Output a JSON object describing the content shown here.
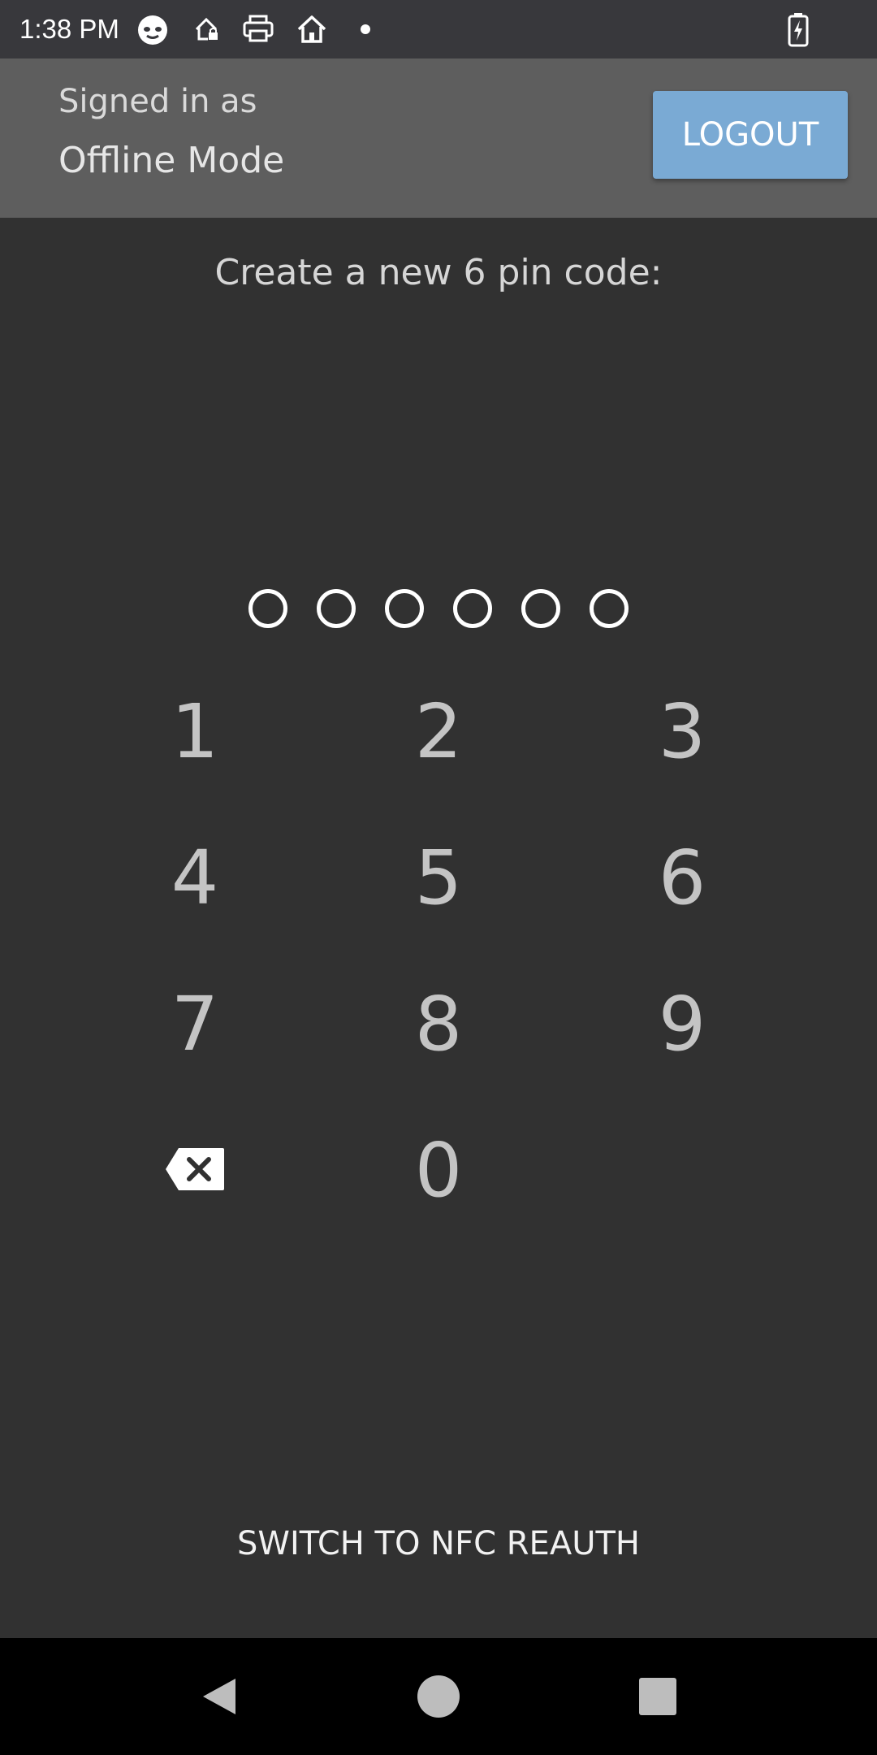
{
  "status_bar": {
    "time": "1:38 PM",
    "icons": [
      "cat-face-icon",
      "home-lock-icon",
      "printer-icon",
      "home-icon",
      "dot-icon",
      "battery-charging-icon"
    ]
  },
  "header": {
    "signed_in_label": "Signed in as",
    "user": "Offline Mode",
    "logout_label": "LOGOUT"
  },
  "prompt": "Create a new 6 pin code:",
  "pin": {
    "length": 6,
    "filled": 0
  },
  "keypad": {
    "keys": [
      "1",
      "2",
      "3",
      "4",
      "5",
      "6",
      "7",
      "8",
      "9",
      "0"
    ],
    "backspace_icon": "backspace-icon"
  },
  "switch_label": "SWITCH TO NFC REAUTH",
  "nav_bar": {
    "icons": [
      "back-icon",
      "home-circle-icon",
      "recents-icon"
    ]
  },
  "colors": {
    "background": "#313131",
    "header": "#5e5e5e",
    "logout_button": "#7aaad4",
    "status_bar": "#38383c",
    "nav_bar": "#000000"
  }
}
